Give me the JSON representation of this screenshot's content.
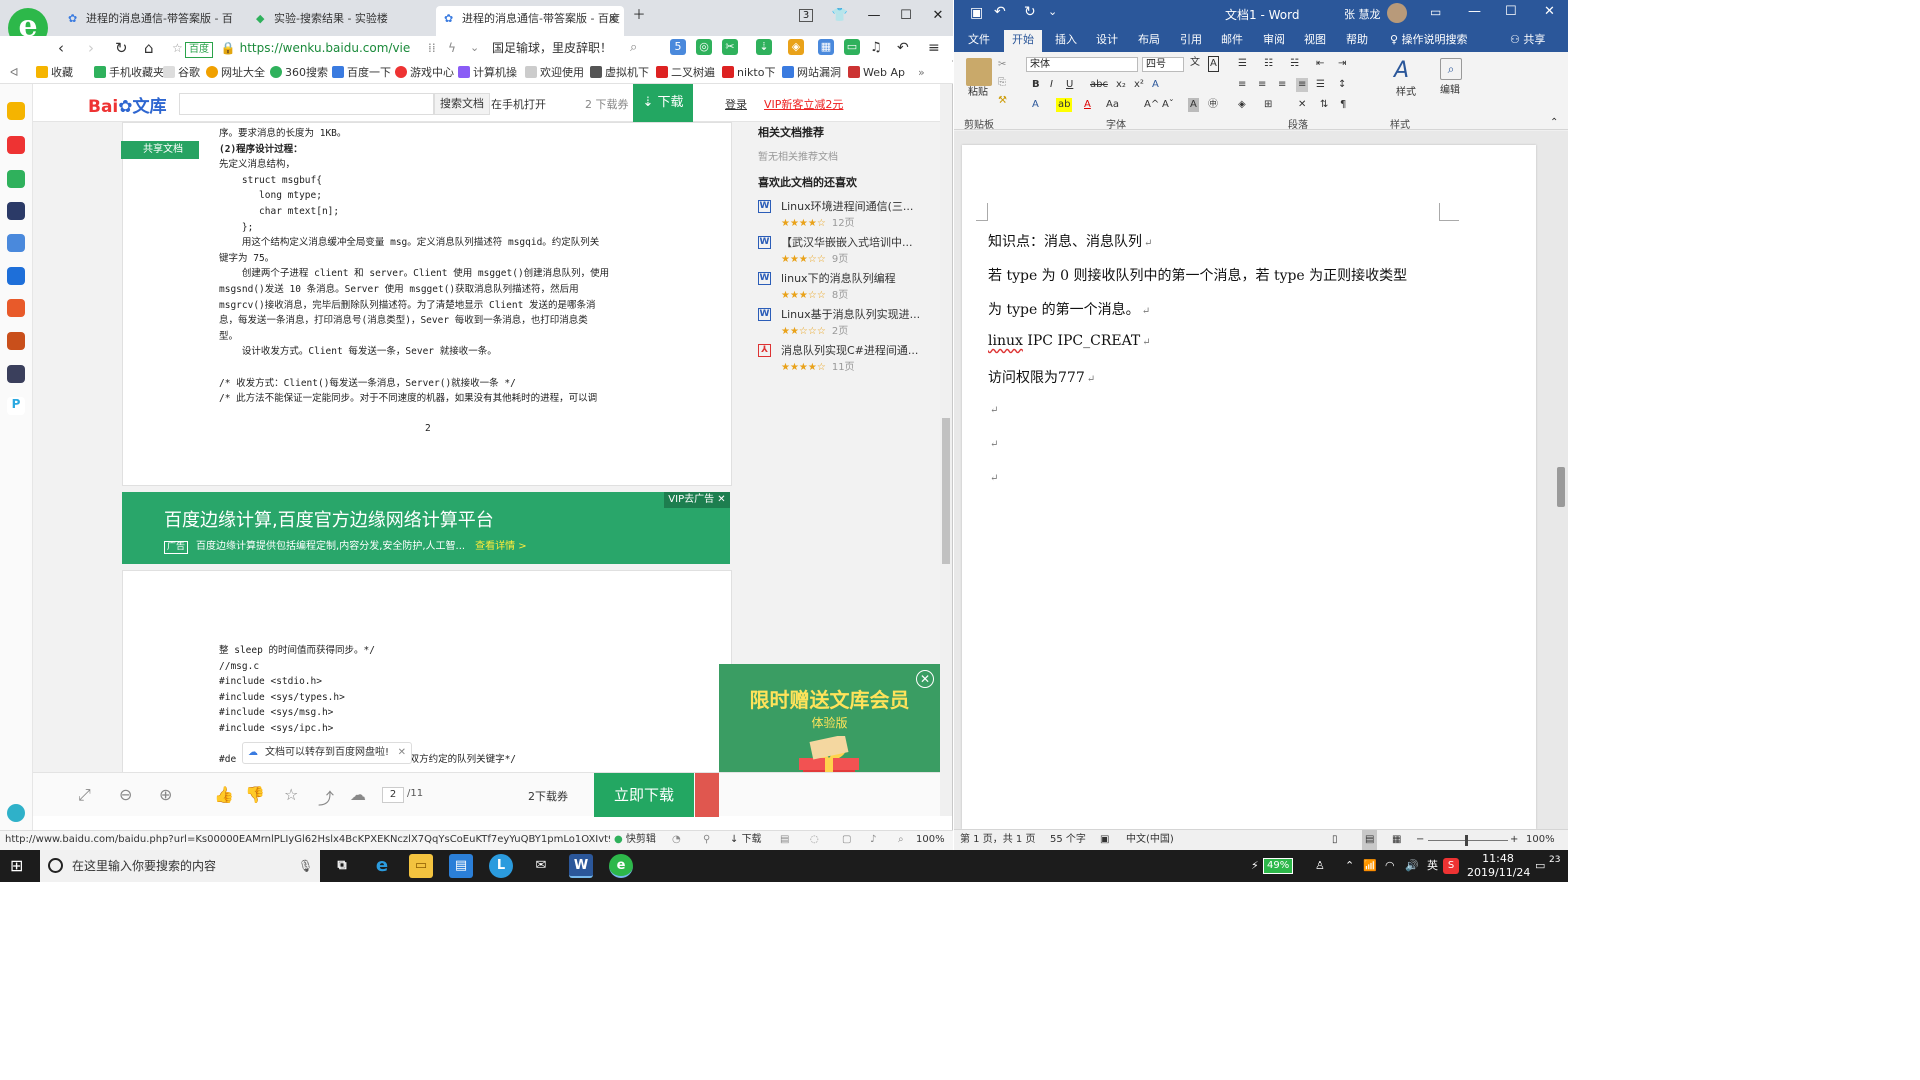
{
  "browser": {
    "logo_letter": "e",
    "tabs": [
      {
        "label": "进程的消息通信-带答案版 - 百度"
      },
      {
        "label": "实验-搜索结果 - 实验楼"
      },
      {
        "label": "进程的消息通信-带答案版 - 百度"
      }
    ],
    "tab_badge": "3",
    "address": {
      "secure_label": "百度",
      "url": "https://wenku.baidu.com/vie"
    },
    "nav_search_text": "国足输球，里皮辞职！",
    "ext_badge": "5",
    "bookmarks": [
      "收藏",
      "手机收藏夹",
      "谷歌",
      "网址大全",
      "360搜索",
      "百度一下",
      "游戏中心",
      "计算机操",
      "欢迎使用",
      "虚拟机下",
      "二叉树遍",
      "nikto下",
      "网站漏洞",
      "Web Ap"
    ],
    "status_url": "http://www.baidu.com/baidu.php?url=Ks00000EAMrnlPLIyGl62Hslx4BcKPXEKNczlX7QqYsCoEuKTf7eyYuQBY1pmLo1OXIvt9f4D3F",
    "status_items": [
      "快剪辑",
      "下载",
      "100%"
    ]
  },
  "wenku": {
    "logo_left": "Bai",
    "logo_right": "文库",
    "search_button": "搜索文档",
    "open_in_phone": "在手机打开",
    "download_count": "2 下载券",
    "download_button": "下载",
    "login": "登录",
    "vip_offer": "VIP新客立减2元",
    "share_tag": "共享文档",
    "page1_lines": [
      "序。要求消息的长度为 1KB。",
      "(2)程序设计过程：",
      "先定义消息结构，",
      "    struct msgbuf{",
      "       long mtype;",
      "       char mtext[n];",
      "    };",
      "    用这个结构定义消息缓冲全局变量 msg。定义消息队列描述符 msgqid。约定队列关",
      "键字为 75。",
      "    创建两个子进程 client 和 server。Client 使用 msgget()创建消息队列，使用",
      "msgsnd()发送 10 条消息。Server 使用 msgget()获取消息队列描述符，然后用",
      "msgrcv()接收消息，完毕后删除队列描述符。为了清楚地显示 Client 发送的是哪条消",
      "息，每发送一条消息，打印消息号(消息类型)，Sever 每收到一条消息，也打印消息类",
      "型。",
      "    设计收发方式。Client 每发送一条，Sever 就接收一条。",
      "",
      "/* 收发方式：Client()每发送一条消息，Server()就接收一条 */",
      "/* 此方法不能保证一定能同步。对于不同速度的机器，如果没有其他耗时的进程，可以调"
    ],
    "page_number": "2",
    "page2_lines": [
      "整 sleep 的时间值而获得同步。*/",
      "//msg.c",
      "#include <stdio.h>",
      "#include <sys/types.h>",
      "#include <sys/msg.h>",
      "#include <sys/ipc.h>",
      "",
      "#de                    /*     通信双方约定的队列关键字*/"
    ],
    "ad": {
      "title": "百度边缘计算,百度官方边缘网络计算平台",
      "tag": "广告",
      "sub": "百度边缘计算提供包括编程定制,内容分发,安全防护,人工智...",
      "more": "查看详情 >",
      "vip": "VIP去广告 ✕"
    },
    "right": {
      "related_title": "相关文档推荐",
      "related_empty": "暂无相关推荐文档",
      "also_like_title": "喜欢此文档的还喜欢",
      "items": [
        {
          "type": "W",
          "title": "Linux环境进程间通信(三...",
          "stars": "★★★★☆",
          "pages": "12页"
        },
        {
          "type": "W",
          "title": "【武汉华嵌嵌入式培训中...",
          "stars": "★★★☆☆",
          "pages": "9页"
        },
        {
          "type": "W",
          "title": "linux下的消息队列编程",
          "stars": "★★★☆☆",
          "pages": "8页"
        },
        {
          "type": "W",
          "title": "Linux基于消息队列实现进...",
          "stars": "★★☆☆☆",
          "pages": "2页"
        },
        {
          "type": "PDF",
          "title": "消息队列实现C#进程间通...",
          "stars": "★★★★☆",
          "pages": "11页"
        }
      ]
    },
    "promo": {
      "title": "限时赠送文库会员",
      "sub": "体验版"
    },
    "save_tip": "文档可以转存到百度网盘啦!",
    "bottom": {
      "page_current": "2",
      "page_total": "/11",
      "download_count": "2下载券",
      "download_button": "立即下载"
    }
  },
  "word": {
    "title": "文档1 - Word",
    "user": "张 慧龙",
    "tabs": [
      "文件",
      "开始",
      "插入",
      "设计",
      "布局",
      "引用",
      "邮件",
      "审阅",
      "视图",
      "帮助",
      "操作说明搜索",
      "共享"
    ],
    "ribbon": {
      "paste": "粘贴",
      "clipboard": "剪贴板",
      "font_name": "宋体",
      "font_size": "四号",
      "font_group": "字体",
      "para_group": "段落",
      "styles": "样式",
      "styles_group": "样式",
      "edit": "编辑"
    },
    "doc_lines": [
      "知识点：消息、消息队列",
      "若 type 为 0 则接收队列中的第一个消息，若 type 为正则接收类型",
      "为 type 的第一个消息。",
      "IPC          IPC_CREAT",
      "访问权限为777"
    ],
    "doc_linux": "linux",
    "para_mark": "↵",
    "status": {
      "pages": "第 1 页，共 1 页",
      "words": "55 个字",
      "lang": "中文(中国)",
      "zoom": "100%"
    }
  },
  "taskbar": {
    "search_placeholder": "在这里输入你要搜索的内容",
    "battery": "49%",
    "ime": "英",
    "time": "11:48",
    "date": "2019/11/24",
    "notif_count": "23"
  },
  "colors": {
    "word_blue": "#2b579a",
    "wenku_green": "#23a762",
    "vip_red": "#e22"
  }
}
